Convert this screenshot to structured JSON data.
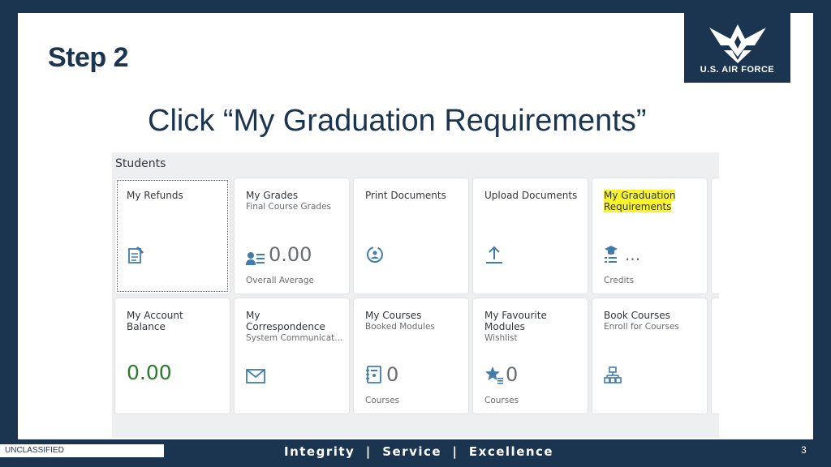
{
  "slide": {
    "title": "Step 2",
    "instruction": "Click “My Graduation Requirements”",
    "logo_text": "U.S. AIR FORCE"
  },
  "app": {
    "section_label": "Students",
    "tiles": [
      {
        "title": "My Refunds",
        "icon": "document-edit-icon"
      },
      {
        "title": "My Grades",
        "subtitle": "Final Course Grades",
        "value": "0.00",
        "footer": "Overall Average",
        "icon": "grades-icon"
      },
      {
        "title": "Print Documents",
        "icon": "print-status-icon"
      },
      {
        "title": "Upload Documents",
        "icon": "upload-icon"
      },
      {
        "title": "My Graduation Requirements",
        "value": "...",
        "footer": "Credits",
        "icon": "graduation-icon",
        "highlight_color": "#f8f32b"
      },
      {
        "title": "My Account Balance",
        "value": "0.00",
        "value_color": "#2b7d2b"
      },
      {
        "title": "My Correspondence",
        "subtitle": "System Communicat...",
        "icon": "envelope-icon"
      },
      {
        "title": "My Courses",
        "subtitle": "Booked Modules",
        "value": "0",
        "footer": "Courses",
        "icon": "course-book-icon"
      },
      {
        "title": "My Favourite Modules",
        "subtitle": "Wishlist",
        "value": "0",
        "footer": "Courses",
        "icon": "favorite-list-icon"
      },
      {
        "title": "Book Courses",
        "subtitle": "Enroll for Courses",
        "icon": "hierarchy-icon"
      }
    ]
  },
  "footer": {
    "classification": "UNCLASSIFIED",
    "motto": "Integrity  |  Service  |  Excellence",
    "page_number": "3"
  },
  "colors": {
    "navy": "#1b3550",
    "icon_blue": "#427cac",
    "highlight": "#f8f32b",
    "balance_green": "#2b7d2b"
  }
}
